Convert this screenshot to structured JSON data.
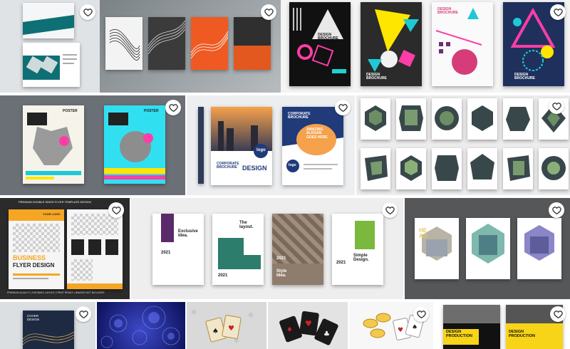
{
  "grid": {
    "favorite_icon": "heart-outline-icon",
    "tiles": [
      {
        "id": "tri-fold-teal",
        "lines": []
      },
      {
        "id": "abstract-wave-covers",
        "lines": []
      },
      {
        "id": "memphis-design-brochure",
        "lines": [
          "DESIGN",
          "BROCHURE"
        ]
      },
      {
        "id": "poster-retro-animals",
        "lines": [
          "POSTER"
        ]
      },
      {
        "id": "corporate-brochure",
        "lines": [
          "CORPORATE",
          "BROCHURE",
          "DESIGN",
          "logo",
          "AMAZING",
          "SLOGAN",
          "GOES HERE"
        ]
      },
      {
        "id": "hexagon-photo-covers",
        "lines": []
      },
      {
        "id": "business-flyer",
        "lines": [
          "PREMIUM DOUBLE SIDED FLYER TEMPLATE DESIGN",
          "YOUR LOGO",
          "BUSINESS",
          "FLYER DESIGN",
          "PREMIUM QUALITY | EDITABLE LAYOUT | PRINT READY | IMAGES NOT INCLUDED"
        ]
      },
      {
        "id": "minimal-covers-2021",
        "lines": [
          "Exclusive",
          "Idea.",
          "The",
          "layout.",
          "Simple",
          "Design.",
          "Style",
          "Idea.",
          "2021"
        ]
      },
      {
        "id": "dark-hexagon-covers",
        "lines": [
          "HE",
          "AD"
        ]
      },
      {
        "id": "cover-design-wave",
        "lines": [
          "COVER",
          "DESIGN"
        ]
      },
      {
        "id": "blue-spheres",
        "lines": []
      },
      {
        "id": "playing-cards",
        "lines": []
      },
      {
        "id": "casino-cards",
        "lines": []
      },
      {
        "id": "poker-chips",
        "lines": []
      },
      {
        "id": "design-production-yellow",
        "lines": [
          "DESIGN",
          "PRODUCTION",
          "DESIGN",
          "PRODUCTION"
        ]
      }
    ]
  }
}
